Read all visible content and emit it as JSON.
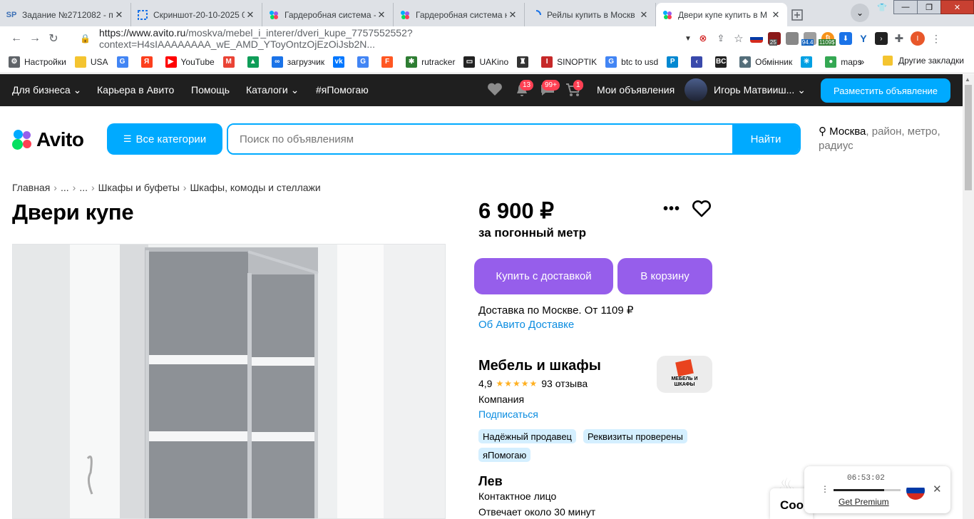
{
  "browser": {
    "tabs": [
      {
        "icon": "sp-icon",
        "title": "Задание №2712082 - п"
      },
      {
        "icon": "screenshot-icon",
        "title": "Скриншот-20-10-2025 0"
      },
      {
        "icon": "avito-icon",
        "title": "Гардеробная система -"
      },
      {
        "icon": "avito-icon",
        "title": "Гардеробная система н"
      },
      {
        "icon": "loading-icon",
        "title": "Рейлы купить в Москв"
      },
      {
        "icon": "avito-icon",
        "title": "Двери купе купить в М"
      }
    ],
    "url_prefix": "https://www.avito.ru",
    "url_rest": "/moskva/mebel_i_interer/dveri_kupe_7757552552?context=H4sIAAAAAAAA_wE_AMD_YToyOntzOjEzOiJsb2N...",
    "ext_badges": {
      "badge1": "25",
      "badge2": "94.4",
      "badge3": "1109$"
    },
    "bookmarks": [
      {
        "icon": "gear-icon",
        "label": "Настройки",
        "color": "#5f6368"
      },
      {
        "icon": "folder-icon",
        "label": "USA",
        "color": "#f4c430"
      },
      {
        "icon": "google-icon",
        "label": "",
        "color": "#4285f4"
      },
      {
        "icon": "yandex-icon",
        "label": "",
        "color": "#fc3f1d"
      },
      {
        "icon": "youtube-icon",
        "label": "YouTube",
        "color": "#ff0000"
      },
      {
        "icon": "gmail-icon",
        "label": "",
        "color": "#ea4335"
      },
      {
        "icon": "drive-icon",
        "label": "",
        "color": "#0f9d58"
      },
      {
        "icon": "loop-icon",
        "label": "загрузчик",
        "color": "#1a73e8"
      },
      {
        "icon": "vk-icon",
        "label": "",
        "color": "#0077ff"
      },
      {
        "icon": "translate-icon",
        "label": "",
        "color": "#4285f4"
      },
      {
        "icon": "f-icon",
        "label": "",
        "color": "#ff5722"
      },
      {
        "icon": "rutracker-icon",
        "label": "rutracker",
        "color": "#2e7d32"
      },
      {
        "icon": "uakino-icon",
        "label": "UAKino",
        "color": "#222222"
      },
      {
        "icon": "person-icon",
        "label": "",
        "color": "#333333"
      },
      {
        "icon": "thermometer-icon",
        "label": "SINOPTIK",
        "color": "#c62828"
      },
      {
        "icon": "google-icon",
        "label": "btc to usd",
        "color": "#4285f4"
      },
      {
        "icon": "p-icon",
        "label": "",
        "color": "#0288d1"
      },
      {
        "icon": "arrow-icon",
        "label": "",
        "color": "#3949ab"
      },
      {
        "icon": "bc-icon",
        "label": "",
        "color": "#222222"
      },
      {
        "icon": "exchange-icon",
        "label": "Обмінник",
        "color": "#546e7a"
      },
      {
        "icon": "kyivstar-icon",
        "label": "",
        "color": "#00a0e3"
      },
      {
        "icon": "maps-icon",
        "label": "maps",
        "color": "#34a853"
      }
    ],
    "bookmarks_more": "»",
    "other_bookmarks": "Другие закладки"
  },
  "avito": {
    "topnav": {
      "business": "Для бизнеса",
      "career": "Карьера в Авито",
      "help": "Помощь",
      "catalogs": "Каталоги",
      "charity": "#яПомогаю",
      "notif_count": "13",
      "msg_count": "99+",
      "cart_count": "1",
      "my_ads": "Мои объявления",
      "user": "Игорь Матвииш...",
      "place_ad": "Разместить объявление"
    },
    "logo": "Avito",
    "all_categories": "Все категории",
    "search_placeholder": "Поиск по объявлениям",
    "find": "Найти",
    "location_city": "Москва",
    "location_rest": ", район, метро, радиус",
    "breadcrumbs": [
      "Главная",
      "...",
      "...",
      "Шкафы и буфеты",
      "Шкафы, комоды и стеллажи"
    ],
    "title": "Двери купе",
    "price": "6 900 ₽",
    "price_unit": "за погонный метр",
    "buy_delivery": "Купить с доставкой",
    "to_cart": "В корзину",
    "delivery_text": "Доставка по Москве. От 1109 ₽",
    "delivery_link": "Об Авито Доставке",
    "seller_name": "Мебель и шкафы",
    "seller_rating": "4,9",
    "seller_reviews": "93 отзыва",
    "seller_type": "Компания",
    "subscribe": "Подписаться",
    "seller_logo_text": "МЕБЕЛЬ И ШКАФЫ",
    "tags": [
      "Надёжный продавец",
      "Реквизиты проверены",
      "яПомогаю"
    ],
    "contact_name": "Лев",
    "contact_role": "Контактное лицо",
    "contact_reply": "Отвечает около 30 минут"
  },
  "widget": {
    "time": "06:53:02",
    "premium": "Get Premium",
    "progress": 0.75
  },
  "cookie_partial": "Coo"
}
